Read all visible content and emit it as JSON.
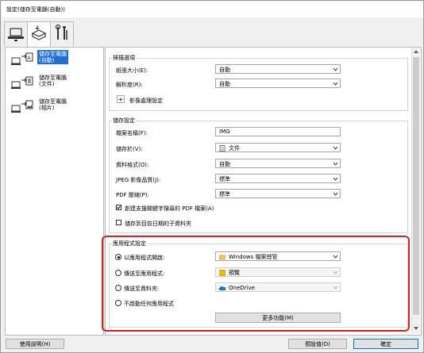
{
  "window": {
    "title": "設定(儲存至電腦(自動))"
  },
  "tabs": [
    {
      "icon": "computer-scan-icon"
    },
    {
      "icon": "scanner-icon"
    },
    {
      "icon": "tools-icon"
    }
  ],
  "sidebar": {
    "items": [
      {
        "label1": "儲存至電腦",
        "label2": "(自動)",
        "selected": true
      },
      {
        "label1": "儲存至電腦",
        "label2": "(文件)",
        "selected": false
      },
      {
        "label1": "儲存至電腦",
        "label2": "(相片)",
        "selected": false
      }
    ]
  },
  "scan_options": {
    "title": "掃描選項",
    "paper_size_label": "紙張大小(E):",
    "paper_size_value": "自動",
    "resolution_label": "解析度(R):",
    "resolution_value": "自動",
    "image_processing_label": "影像處理設定"
  },
  "save_settings": {
    "title": "儲存設定",
    "filename_label": "檔案名稱(F):",
    "filename_value": "IMG",
    "save_in_label": "儲存於(V):",
    "save_in_value": "文件",
    "data_format_label": "資料格式(O):",
    "data_format_value": "自動",
    "jpeg_quality_label": "JPEG 影像品質(J):",
    "jpeg_quality_value": "標準",
    "pdf_compression_label": "PDF 壓縮(P):",
    "pdf_compression_value": "標準",
    "searchable_pdf_label": "創建支援關鍵字搜尋的 PDF 檔案(A)",
    "searchable_pdf_checked": true,
    "subfolder_label": "儲存到目前日期的子資料夾",
    "subfolder_checked": false
  },
  "app_settings": {
    "title": "應用程式設定",
    "open_with_label": "以應用程式開啟:",
    "open_with_value": "Windows 檔案總管",
    "send_app_label": "傳送至應用程式:",
    "send_app_value": "預覽",
    "send_folder_label": "傳送至資料夾:",
    "send_folder_value": "OneDrive",
    "no_app_label": "不啟動任何應用程式",
    "more_functions_label": "更多功能(M)",
    "selected_option": "open_with"
  },
  "footer": {
    "help_label": "使用說明(H)",
    "defaults_label": "預設值(D)",
    "ok_label": "確定"
  }
}
